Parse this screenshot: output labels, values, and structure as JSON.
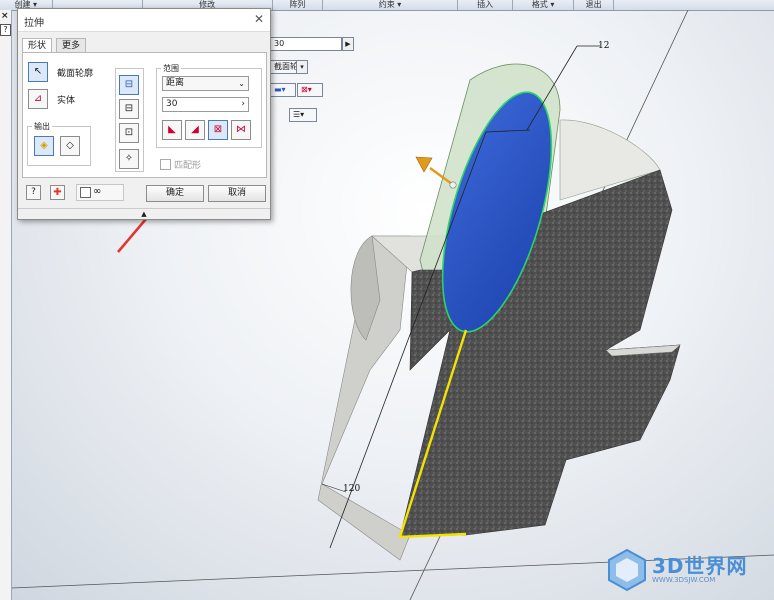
{
  "ribbon": {
    "sections": [
      {
        "label": "创建 ▾",
        "w": 0
      },
      {
        "label": "",
        "w": 0
      },
      {
        "label": "修改",
        "w": 0
      },
      {
        "label": "阵列",
        "w": 0
      },
      {
        "label": "约束 ▾",
        "w": 0
      },
      {
        "label": "插入",
        "w": 0
      },
      {
        "label": "格式 ▾",
        "w": 0
      },
      {
        "label": "退出",
        "w": 0
      }
    ]
  },
  "left_panel": {
    "close_glyph": "×",
    "help_glyph": "?"
  },
  "mini_toolbar": {
    "distance_value": "30",
    "profile_label": "截面轮廓"
  },
  "dialog": {
    "title": "拉伸",
    "close_glyph": "✕",
    "tabs": [
      "形状",
      "更多"
    ],
    "profile_label": "截面轮廓",
    "solid_label": "实体",
    "output_label": "输出",
    "range_label": "范围",
    "range_type": "距离",
    "distance_value": "30",
    "match_shape_label": "匹配形",
    "ok_label": "确定",
    "cancel_label": "取消",
    "glasses_glyph": "∞"
  },
  "dimensions": {
    "top": "12",
    "left": "120"
  },
  "watermark": {
    "brand": "3D世界网",
    "url": "WWW.3DSJW.COM"
  },
  "colors": {
    "profile_blue": "#2a55c8",
    "preview_green": "#cfe0c8",
    "annotation_red": "#e2372e",
    "solid_dark": "#505050",
    "solid_light": "#cfcfcc",
    "highlight_yellow": "#f2e300"
  }
}
